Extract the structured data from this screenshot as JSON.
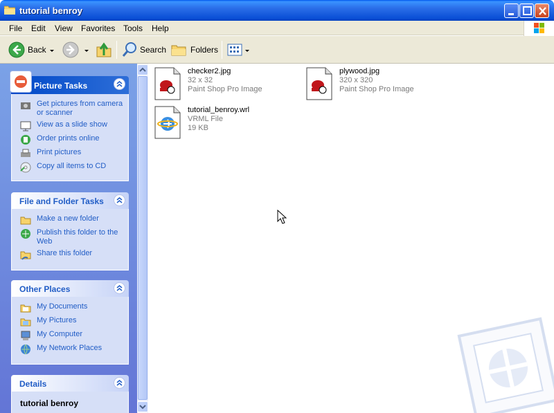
{
  "window": {
    "title": "tutorial benroy"
  },
  "menu": [
    "File",
    "Edit",
    "View",
    "Favorites",
    "Tools",
    "Help"
  ],
  "toolbar": {
    "back_label": "Back",
    "search_label": "Search",
    "folders_label": "Folders"
  },
  "panels": {
    "picture_tasks": {
      "title": "Picture Tasks",
      "items": [
        "Get pictures from camera or scanner",
        "View as a slide show",
        "Order prints online",
        "Print pictures",
        "Copy all items to CD"
      ]
    },
    "file_folder_tasks": {
      "title": "File and Folder Tasks",
      "items": [
        "Make a new folder",
        "Publish this folder to the Web",
        "Share this folder"
      ]
    },
    "other_places": {
      "title": "Other Places",
      "items": [
        "My Documents",
        "My Pictures",
        "My Computer",
        "My Network Places"
      ]
    },
    "details": {
      "title": "Details",
      "name": "tutorial benroy"
    }
  },
  "files": [
    {
      "name": "checker2.jpg",
      "dims": "32 x 32",
      "type": "Paint Shop Pro Image"
    },
    {
      "name": "plywood.jpg",
      "dims": "320 x 320",
      "type": "Paint Shop Pro Image"
    },
    {
      "name": "tutorial_benroy.wrl",
      "type": "VRML File",
      "size": "19 KB"
    }
  ],
  "colors": {
    "title_blue": "#0a4fd6",
    "task_link": "#215dc6",
    "pane_bg": "#6f8ddd"
  }
}
